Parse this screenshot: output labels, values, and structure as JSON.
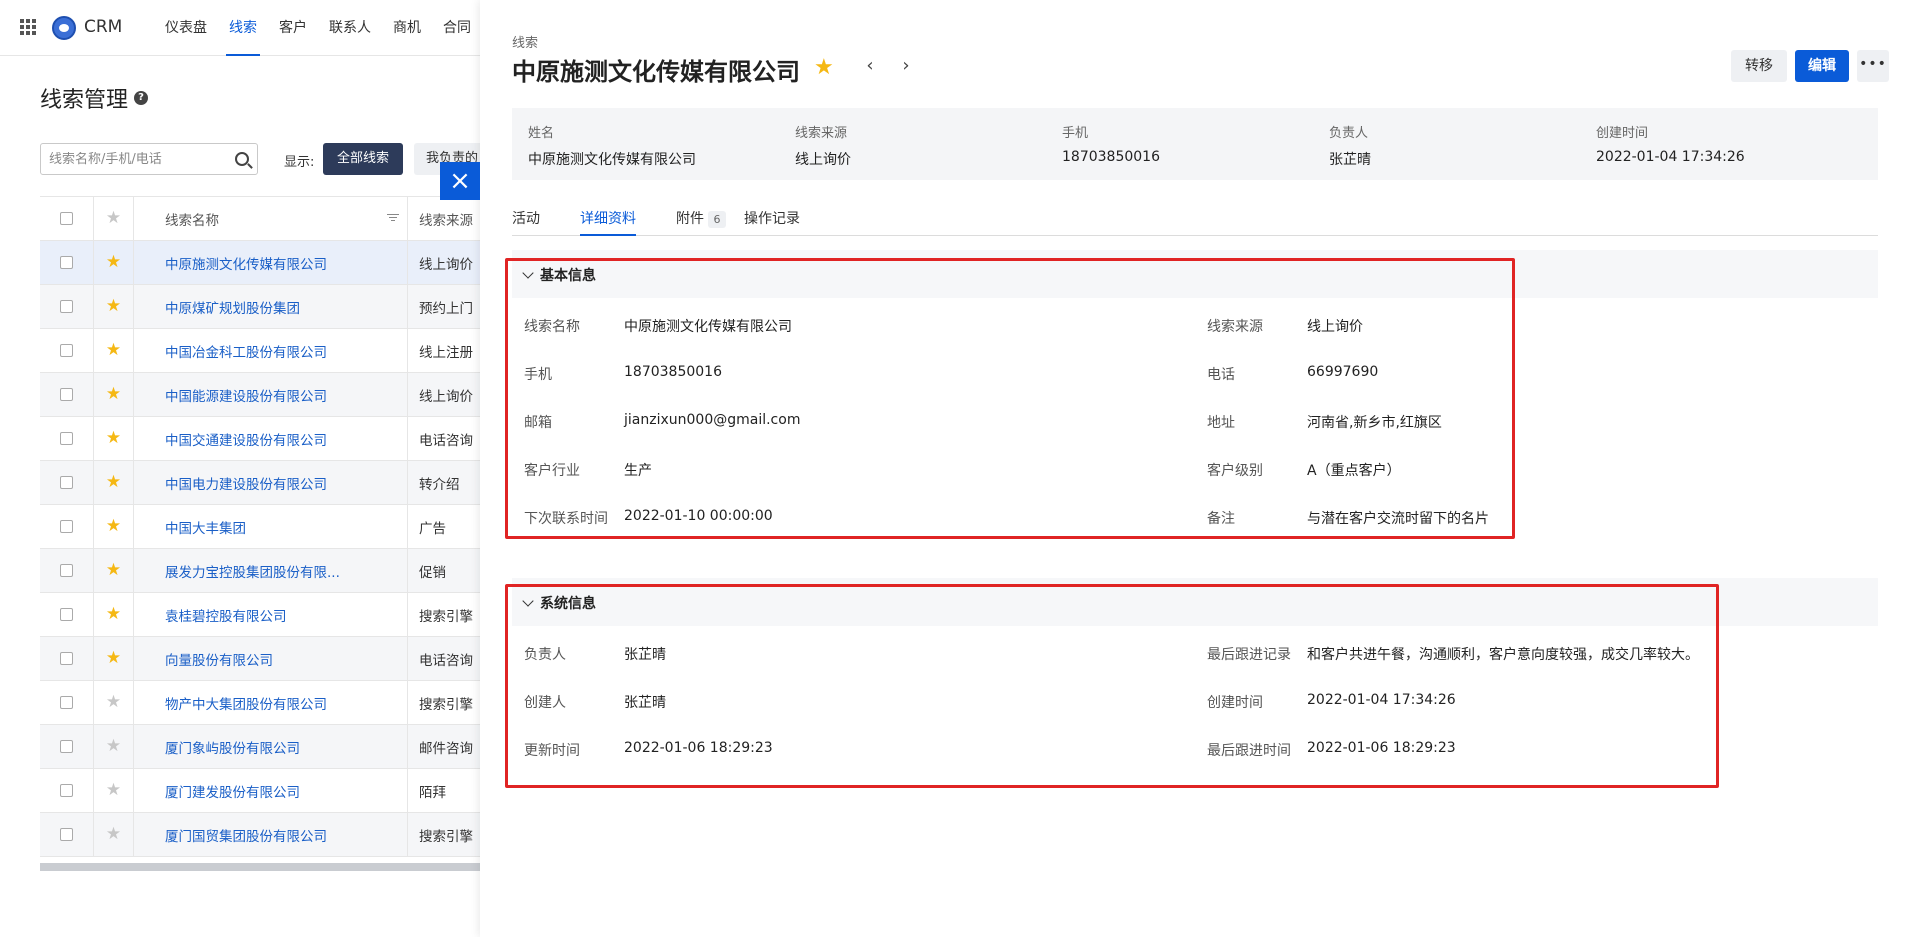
{
  "topbar": {
    "brand": "CRM",
    "nav": [
      "仪表盘",
      "线索",
      "客户",
      "联系人",
      "商机",
      "合同"
    ],
    "active_nav": "线索"
  },
  "list_page": {
    "title": "线索管理",
    "search_placeholder": "线索名称/手机/电话",
    "show_label": "显示:",
    "filter_all": "全部线索",
    "filter_mine": "我负责的",
    "columns": {
      "name": "线索名称",
      "source": "线索来源"
    },
    "rows": [
      {
        "name": "中原施测文化传媒有限公司",
        "source": "线上询价",
        "starred": true
      },
      {
        "name": "中原煤矿规划股份集团",
        "source": "预约上门",
        "starred": true
      },
      {
        "name": "中国冶金科工股份有限公司",
        "source": "线上注册",
        "starred": true
      },
      {
        "name": "中国能源建设股份有限公司",
        "source": "线上询价",
        "starred": true
      },
      {
        "name": "中国交通建设股份有限公司",
        "source": "电话咨询",
        "starred": true
      },
      {
        "name": "中国电力建设股份有限公司",
        "source": "转介绍",
        "starred": true
      },
      {
        "name": "中国大丰集团",
        "source": "广告",
        "starred": true
      },
      {
        "name": "展发力宝控股集团股份有限...",
        "source": "促销",
        "starred": true
      },
      {
        "name": "袁桂碧控股有限公司",
        "source": "搜索引擎",
        "starred": true
      },
      {
        "name": "向量股份有限公司",
        "source": "电话咨询",
        "starred": true
      },
      {
        "name": "物产中大集团股份有限公司",
        "source": "搜索引擎",
        "starred": false
      },
      {
        "name": "厦门象屿股份有限公司",
        "source": "邮件咨询",
        "starred": false
      },
      {
        "name": "厦门建发股份有限公司",
        "source": "陌拜",
        "starred": false
      },
      {
        "name": "厦门国贸集团股份有限公司",
        "source": "搜索引擎",
        "starred": false
      }
    ]
  },
  "drawer": {
    "close_icon": "×",
    "type_label": "线索",
    "title": "中原施测文化传媒有限公司",
    "prev_icon": "‹",
    "next_icon": "›",
    "transfer_label": "转移",
    "edit_label": "编辑",
    "more_label": "•••",
    "summary": [
      {
        "label": "姓名",
        "value": "中原施测文化传媒有限公司"
      },
      {
        "label": "线索来源",
        "value": "线上询价"
      },
      {
        "label": "手机",
        "value": "18703850016"
      },
      {
        "label": "负责人",
        "value": "张芷晴"
      },
      {
        "label": "创建时间",
        "value": "2022-01-04 17:34:26"
      }
    ],
    "tabs": {
      "activity": "活动",
      "details": "详细资料",
      "attachments": "附件",
      "attachments_count": "6",
      "log": "操作记录"
    },
    "basic": {
      "title": "基本信息",
      "left": [
        {
          "label": "线索名称",
          "value": "中原施测文化传媒有限公司"
        },
        {
          "label": "手机",
          "value": "18703850016"
        },
        {
          "label": "邮箱",
          "value": "jianzixun000@gmail.com"
        },
        {
          "label": "客户行业",
          "value": "生产"
        },
        {
          "label": "下次联系时间",
          "value": "2022-01-10 00:00:00"
        }
      ],
      "right": [
        {
          "label": "线索来源",
          "value": "线上询价"
        },
        {
          "label": "电话",
          "value": "66997690"
        },
        {
          "label": "地址",
          "value": "河南省,新乡市,红旗区"
        },
        {
          "label": "客户级别",
          "value": "A（重点客户）"
        },
        {
          "label": "备注",
          "value": "与潜在客户交流时留下的名片"
        }
      ]
    },
    "system": {
      "title": "系统信息",
      "left": [
        {
          "label": "负责人",
          "value": "张芷晴"
        },
        {
          "label": "创建人",
          "value": "张芷晴"
        },
        {
          "label": "更新时间",
          "value": "2022-01-06 18:29:23"
        }
      ],
      "right": [
        {
          "label": "最后跟进记录",
          "value": "和客户共进午餐，沟通顺利，客户意向度较强，成交几率较大。"
        },
        {
          "label": "创建时间",
          "value": "2022-01-04 17:34:26"
        },
        {
          "label": "最后跟进时间",
          "value": "2022-01-06 18:29:23"
        }
      ]
    }
  }
}
